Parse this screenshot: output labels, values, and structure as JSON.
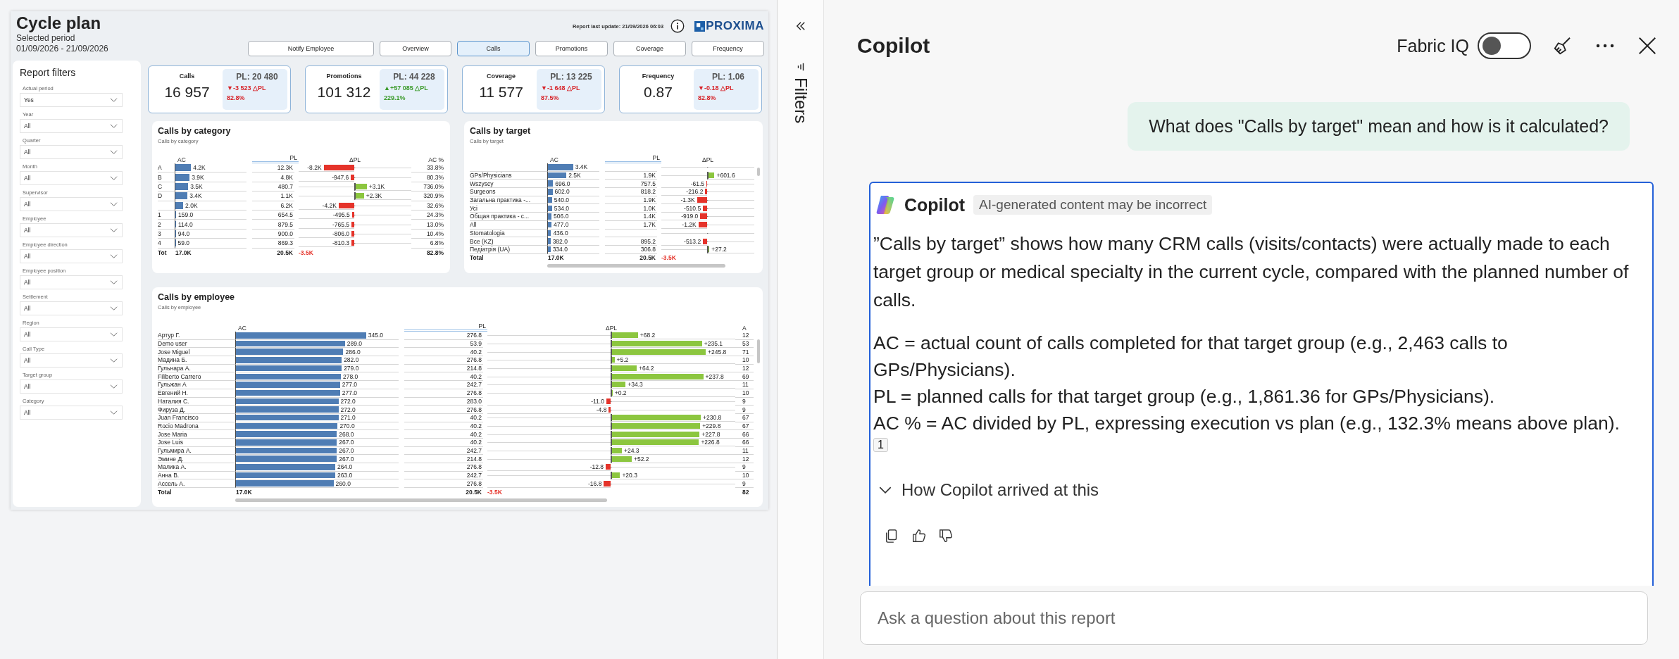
{
  "report": {
    "title": "Cycle plan",
    "period_label": "Selected period",
    "period": "01/09/2026 - 21/09/2026",
    "last_update": "Report last update: 21/09/2026 06:03",
    "logo": "PROXIMA",
    "nav": [
      {
        "label": "Notify Employee",
        "selected": false
      },
      {
        "label": "Overview",
        "selected": false
      },
      {
        "label": "Calls",
        "selected": true
      },
      {
        "label": "Promotions",
        "selected": false
      },
      {
        "label": "Coverage",
        "selected": false
      },
      {
        "label": "Frequency",
        "selected": false
      }
    ],
    "filters": {
      "title": "Report filters",
      "items": [
        {
          "label": "Actual period",
          "value": "Yes"
        },
        {
          "label": "Year",
          "value": "All"
        },
        {
          "label": "Quarter",
          "value": "All"
        },
        {
          "label": "Month",
          "value": "All"
        },
        {
          "label": "Supervisor",
          "value": "All"
        },
        {
          "label": "Employee",
          "value": "All"
        },
        {
          "label": "Employee direction",
          "value": "All"
        },
        {
          "label": "Employee position",
          "value": "All"
        },
        {
          "label": "Settlement",
          "value": "All"
        },
        {
          "label": "Region",
          "value": "All"
        },
        {
          "label": "Call Type",
          "value": "All"
        },
        {
          "label": "Target group",
          "value": "All"
        },
        {
          "label": "Category",
          "value": "All"
        }
      ]
    },
    "kpis": [
      {
        "label": "Calls",
        "value": "16 957",
        "pl": "PL: 20 480",
        "delta": "▼-3 523 △PL",
        "pct": "82.8%",
        "kind": "decrease"
      },
      {
        "label": "Promotions",
        "value": "101 312",
        "pl": "PL: 44 228",
        "delta": "▲+57 085 △PL",
        "pct": "229.1%",
        "kind": "increase"
      },
      {
        "label": "Coverage",
        "value": "11 577",
        "pl": "PL: 13 225",
        "delta": "▼-1 648 △PL",
        "pct": "87.5%",
        "kind": "decrease"
      },
      {
        "label": "Frequency",
        "value": "0.87",
        "pl": "PL: 1.06",
        "delta": "▼-0.18 △PL",
        "pct": "82.8%",
        "kind": "decrease"
      }
    ],
    "tables": [
      {
        "title": "Calls by category",
        "subtitle": "Calls by category",
        "columns": [
          "AC",
          "PL",
          "ΔPL",
          "AC %"
        ],
        "rows": [
          {
            "label": "A",
            "ac": {
              "value": "4.2K",
              "level": 0.22
            },
            "pl": "12.3K",
            "delta": {
              "value": "-8.2K",
              "level": 0.55,
              "kind": "negative"
            },
            "pct": "33.8%"
          },
          {
            "label": "B",
            "ac": {
              "value": "3.9K",
              "level": 0.2
            },
            "pl": "4.8K",
            "delta": {
              "value": "-947.6",
              "level": 0.06,
              "kind": "negative"
            },
            "pct": "80.3%"
          },
          {
            "label": "C",
            "ac": {
              "value": "3.5K",
              "level": 0.18
            },
            "pl": "480.7",
            "delta": {
              "value": "+3.1K",
              "level": 0.2,
              "kind": "positive"
            },
            "pct": "736.0%"
          },
          {
            "label": "D",
            "ac": {
              "value": "3.4K",
              "level": 0.17
            },
            "pl": "1.1K",
            "delta": {
              "value": "+2.3K",
              "level": 0.15,
              "kind": "positive"
            },
            "pct": "320.9%"
          },
          {
            "ac": {
              "value": "2.0K",
              "level": 0.11
            },
            "pl": "6.2K",
            "delta": {
              "value": "-4.2K",
              "level": 0.28,
              "kind": "negative"
            },
            "pct": "32.6%"
          },
          {
            "label": "1",
            "ac": {
              "value": "159.0",
              "level": 0.01
            },
            "pl": "654.5",
            "delta": {
              "value": "-495.5",
              "level": 0.04,
              "kind": "negative"
            },
            "pct": "24.3%"
          },
          {
            "label": "2",
            "ac": {
              "value": "114.0",
              "level": 0.01
            },
            "pl": "879.5",
            "delta": {
              "value": "-765.5",
              "level": 0.05,
              "kind": "negative"
            },
            "pct": "13.0%"
          },
          {
            "label": "3",
            "ac": {
              "value": "94.0",
              "level": 0.008
            },
            "pl": "900.0",
            "delta": {
              "value": "-806.0",
              "level": 0.05,
              "kind": "negative"
            },
            "pct": "10.4%"
          },
          {
            "label": "4",
            "ac": {
              "value": "59.0",
              "level": 0.005
            },
            "pl": "869.3",
            "delta": {
              "value": "-810.3",
              "level": 0.05,
              "kind": "negative"
            },
            "pct": "6.8%"
          }
        ],
        "total": {
          "label": "Tot",
          "ac": "17.0K",
          "pl": "20.5K",
          "delta": "-3.5K",
          "pct": "82.8%"
        }
      },
      {
        "title": "Calls by target",
        "subtitle": "Calls by target",
        "columns": [
          "AC",
          "PL",
          "ΔPL"
        ],
        "rows": [
          {
            "ac": {
              "value": "3.4K",
              "level": 0.49
            }
          },
          {
            "label": "GPs/Physicians",
            "ac": {
              "value": "2.5K",
              "level": 0.36
            },
            "pl": "1.9K",
            "delta": {
              "value": "+601.6",
              "level": 0.13,
              "kind": "positive"
            }
          },
          {
            "label": "Wszyscy",
            "ac": {
              "value": "696.0",
              "level": 0.1
            },
            "pl": "757.5",
            "delta": {
              "value": "-61.5",
              "level": 0.015,
              "kind": "negative"
            }
          },
          {
            "label": "Surgeons",
            "ac": {
              "value": "602.0",
              "level": 0.09
            },
            "pl": "818.2",
            "delta": {
              "value": "-216.2",
              "level": 0.04,
              "kind": "negative"
            }
          },
          {
            "label": "Загальна практика -...",
            "ac": {
              "value": "540.0",
              "level": 0.08
            },
            "pl": "1.9K",
            "delta": {
              "value": "-1.3K",
              "level": 0.22,
              "kind": "negative"
            }
          },
          {
            "label": "Усі",
            "ac": {
              "value": "534.0",
              "level": 0.08
            },
            "pl": "1.0K",
            "delta": {
              "value": "-510.5",
              "level": 0.09,
              "kind": "negative"
            }
          },
          {
            "label": "Общая практика - с...",
            "ac": {
              "value": "506.0",
              "level": 0.07
            },
            "pl": "1.4K",
            "delta": {
              "value": "-919.0",
              "level": 0.15,
              "kind": "negative"
            }
          },
          {
            "label": "All",
            "ac": {
              "value": "477.0",
              "level": 0.07
            },
            "pl": "1.7K",
            "delta": {
              "value": "-1.2K",
              "level": 0.19,
              "kind": "negative"
            }
          },
          {
            "label": "Stomatologia",
            "ac": {
              "value": "436.0",
              "level": 0.06
            }
          },
          {
            "label": "Все (KZ)",
            "ac": {
              "value": "382.0",
              "level": 0.05
            },
            "pl": "895.2",
            "delta": {
              "value": "-513.2",
              "level": 0.09,
              "kind": "negative"
            }
          },
          {
            "label": "Педіатрія (UA)",
            "ac": {
              "value": "334.0",
              "level": 0.05
            },
            "pl": "306.8",
            "delta": {
              "value": "+27.2",
              "level": 0.02,
              "kind": "positive"
            }
          }
        ],
        "total": {
          "label": "Total",
          "ac": "17.0K",
          "pl": "20.5K",
          "delta": "-3.5K"
        }
      },
      {
        "title": "Calls by employee",
        "subtitle": "Calls by employee",
        "columns": [
          "AC",
          "PL",
          "ΔPL",
          "A"
        ],
        "rows": [
          {
            "label": "Артур Г.",
            "ac": {
              "value": "345.0",
              "level": 0.8
            },
            "pl": "276.8",
            "delta": {
              "value": "+68.2",
              "level": 0.21,
              "kind": "positive"
            },
            "pct": "12"
          },
          {
            "label": "Demo user",
            "ac": {
              "value": "289.0",
              "level": 0.67
            },
            "pl": "53.9",
            "delta": {
              "value": "+235.1",
              "level": 0.73,
              "kind": "positive"
            },
            "pct": "53"
          },
          {
            "label": "Jose Miguel",
            "ac": {
              "value": "286.0",
              "level": 0.66
            },
            "pl": "40.2",
            "delta": {
              "value": "+245.8",
              "level": 0.76,
              "kind": "positive"
            },
            "pct": "71"
          },
          {
            "label": "Мадина Б.",
            "ac": {
              "value": "282.0",
              "level": 0.65
            },
            "pl": "276.8",
            "delta": {
              "value": "+5.2",
              "level": 0.02,
              "kind": "positive"
            },
            "pct": "10"
          },
          {
            "label": "Гульнара А.",
            "ac": {
              "value": "279.0",
              "level": 0.65
            },
            "pl": "214.8",
            "delta": {
              "value": "+64.2",
              "level": 0.2,
              "kind": "positive"
            },
            "pct": "12"
          },
          {
            "label": "Filiberto Carrero",
            "ac": {
              "value": "278.0",
              "level": 0.645
            },
            "pl": "40.2",
            "delta": {
              "value": "+237.8",
              "level": 0.74,
              "kind": "positive"
            },
            "pct": "69"
          },
          {
            "label": "Гульжан А",
            "ac": {
              "value": "277.0",
              "level": 0.64
            },
            "pl": "242.7",
            "delta": {
              "value": "+34.3",
              "level": 0.11,
              "kind": "positive"
            },
            "pct": "11"
          },
          {
            "label": "Евгений Н.",
            "ac": {
              "value": "277.0",
              "level": 0.64
            },
            "pl": "276.8",
            "delta": {
              "value": "+0.2",
              "level": 0.004,
              "kind": "positive"
            },
            "pct": "10"
          },
          {
            "label": "Наталия С.",
            "ac": {
              "value": "272.0",
              "level": 0.63
            },
            "pl": "283.0",
            "delta": {
              "value": "-11.0",
              "level": 0.035,
              "kind": "negative"
            },
            "pct": "9"
          },
          {
            "label": "Фируза Д.",
            "ac": {
              "value": "272.0",
              "level": 0.63
            },
            "pl": "276.8",
            "delta": {
              "value": "-4.8",
              "level": 0.015,
              "kind": "negative"
            },
            "pct": "9"
          },
          {
            "label": "Juan Francisco",
            "ac": {
              "value": "271.0",
              "level": 0.63
            },
            "pl": "40.2",
            "delta": {
              "value": "+230.8",
              "level": 0.72,
              "kind": "positive"
            },
            "pct": "67"
          },
          {
            "label": "Rocio Madrona",
            "ac": {
              "value": "270.0",
              "level": 0.625
            },
            "pl": "40.2",
            "delta": {
              "value": "+229.8",
              "level": 0.715,
              "kind": "positive"
            },
            "pct": "67"
          },
          {
            "label": "Jose Maria",
            "ac": {
              "value": "268.0",
              "level": 0.62
            },
            "pl": "40.2",
            "delta": {
              "value": "+227.8",
              "level": 0.71,
              "kind": "positive"
            },
            "pct": "66"
          },
          {
            "label": "Jose Luis",
            "ac": {
              "value": "267.0",
              "level": 0.62
            },
            "pl": "40.2",
            "delta": {
              "value": "+226.8",
              "level": 0.705,
              "kind": "positive"
            },
            "pct": "66"
          },
          {
            "label": "Гульмира А.",
            "ac": {
              "value": "267.0",
              "level": 0.62
            },
            "pl": "242.7",
            "delta": {
              "value": "+24.3",
              "level": 0.08,
              "kind": "positive"
            },
            "pct": "11"
          },
          {
            "label": "Эмине Д.",
            "ac": {
              "value": "267.0",
              "level": 0.62
            },
            "pl": "214.8",
            "delta": {
              "value": "+52.2",
              "level": 0.16,
              "kind": "positive"
            },
            "pct": "12"
          },
          {
            "label": "Малика А.",
            "ac": {
              "value": "264.0",
              "level": 0.61
            },
            "pl": "276.8",
            "delta": {
              "value": "-12.8",
              "level": 0.04,
              "kind": "negative"
            },
            "pct": "9"
          },
          {
            "label": "Анна В.",
            "ac": {
              "value": "263.0",
              "level": 0.61
            },
            "pl": "242.7",
            "delta": {
              "value": "+20.3",
              "level": 0.065,
              "kind": "positive"
            },
            "pct": "10"
          },
          {
            "label": "Ассель А.",
            "ac": {
              "value": "260.0",
              "level": 0.6
            },
            "pl": "276.8",
            "delta": {
              "value": "-16.8",
              "level": 0.055,
              "kind": "negative"
            },
            "pct": "9"
          }
        ],
        "total": {
          "label": "Total",
          "ac": "17.0K",
          "pl": "20.5K",
          "delta": "-3.5K",
          "pct": "82"
        }
      }
    ]
  },
  "filters_pane": {
    "title": "Filters"
  },
  "copilot": {
    "title": "Copilot",
    "fabric_iq": {
      "label": "Fabric IQ",
      "on": false
    },
    "question": "What does \"Calls by target\" mean and how is it calculated?",
    "answer": {
      "author": "Copilot",
      "badge": "AI-generated content may be incorrect",
      "paragraph": "”Calls by target” shows how many CRM calls (visits/contacts) were actually made to each target group or medical specialty in the current cycle, compared with the planned number of calls.",
      "lines": [
        "AC = actual count of calls completed for that target group (e.g., 2,463 calls to GPs/Physicians).",
        "PL = planned calls for that target group (e.g., 1,861.36 for GPs/Physicians).",
        "AC % = AC divided by PL, expressing execution vs plan (e.g., 132.3% means above plan)."
      ],
      "citation": "1",
      "details": {
        "label": "How Copilot arrived at this",
        "expanded": false
      }
    },
    "input": {
      "placeholder": "Ask a question about this report"
    }
  }
}
